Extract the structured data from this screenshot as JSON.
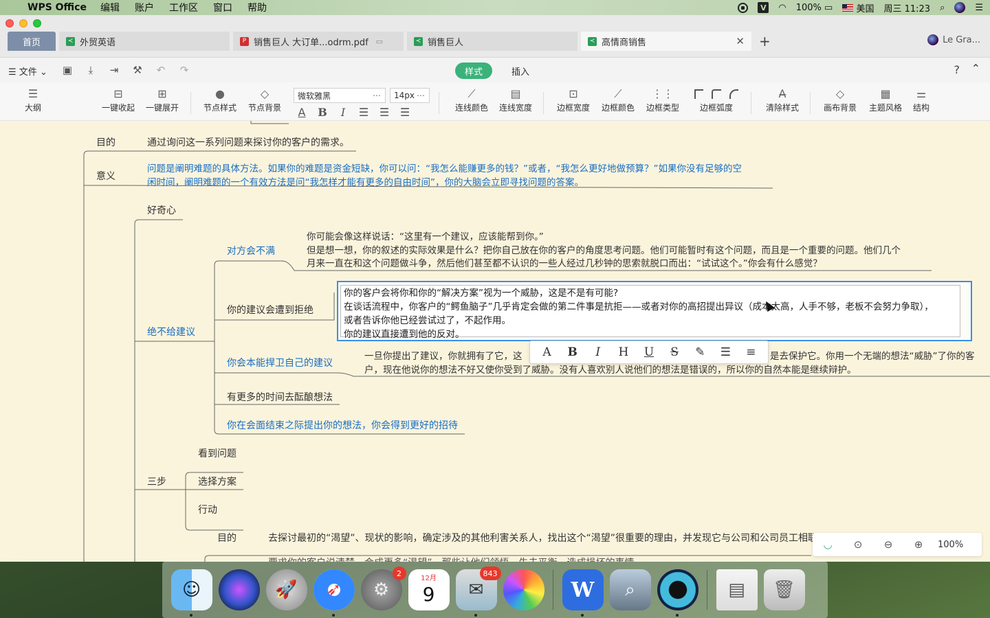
{
  "menubar": {
    "app": "WPS Office",
    "items": [
      "编辑",
      "账户",
      "工作区",
      "窗口",
      "帮助"
    ],
    "battery": "100%",
    "input_source": "美国",
    "clock": "周三 11:23"
  },
  "tabs": {
    "home": "首页",
    "items": [
      "外贸英语",
      "销售巨人 大订单...odrm.pdf",
      "销售巨人",
      "高情商销售"
    ],
    "user": "Le Gra..."
  },
  "toolbar1": {
    "file": "文件",
    "mode_tabs": [
      "样式",
      "插入"
    ],
    "help": "?"
  },
  "toolbar2": {
    "outline": "大纲",
    "collapse_all": "一键收起",
    "expand_all": "一键展开",
    "node_style": "节点样式",
    "node_bg": "节点背景",
    "font_family": "微软雅黑",
    "font_size": "14px",
    "line_color": "连线颜色",
    "line_width": "连线宽度",
    "border_width": "边框宽度",
    "border_color": "边框颜色",
    "border_type": "边框类型",
    "border_radius": "边框弧度",
    "clear_style": "清除样式",
    "canvas_bg": "画布背景",
    "theme": "主题风格",
    "structure": "结构"
  },
  "mindmap": {
    "purpose_label": "目的",
    "purpose_text": "通过询问这一系列问题来探讨你的客户的需求。",
    "meaning_label": "意义",
    "meaning_line1": "问题是阐明难题的具体方法。如果你的难题是资金短缺，你可以问：“我怎么能赚更多的钱？”或者，“我怎么更好地做预算？”如果你没有足够的空",
    "meaning_line2": "闲时间，阐明难题的一个有效方法是问“我怎样才能有更多的自由时间”，你的大脑会立即寻找问题的答案。",
    "curiosity": "好奇心",
    "never_advise": "绝不给建议",
    "dissatisfied": "对方会不满",
    "dissatisfied_line1": "你可能会像这样说话：“这里有一个建议，应该能帮到你。”",
    "dissatisfied_line2": "但是想一想，你的叙述的实际效果是什么？把你自己放在你的客户的角度思考问题。他们可能暂时有这个问题，而且是一个重要的问题。他们几个",
    "dissatisfied_line3": "月来一直在和这个问题做斗争，然后他们甚至都不认识的一些人经过几秒钟的思索就脱口而出：“试试这个。”你会有什么感觉？",
    "rejected": "你的建议会遭到拒绝",
    "edit_line1": "你的客户会将你和你的“解决方案”视为一个威胁，这是不是有可能?",
    "edit_line2": "在谈话流程中，你客户的“鳄鱼脑子”几乎肯定会做的第二件事是抗拒——或者对你的高招提出异议（成本太高，人手不够，老板不会努力争取），",
    "edit_line3": "或者告诉你他已经尝试过了，不起作用。",
    "edit_line4": "你的建议直接遭到他的反对。",
    "defend": "你会本能捍卫自己的建议",
    "defend_line1_a": "一旦你提出了建议，你就拥有了它，这",
    "defend_line1_b": "是去保护它。你用一个无端的想法“威胁”了你的客",
    "defend_line2": "户，现在他说你的想法不好又使你受到了威胁。没有人喜欢别人说他们的想法是错误的，所以你的自然本能是继续辩护。",
    "more_time": "有更多的时间去酝酿想法",
    "end_meeting": "你在会面结束之际提出你的想法，你会得到更好的招待",
    "three_steps": "三步",
    "see_problem": "看到问题",
    "choose_plan": "选择方案",
    "action": "行动",
    "purpose2_label": "目的",
    "purpose2_text": "去探讨最初的“渴望”、现状的影响，确定涉及的其他利害关系人，找出这个“渴望”很重要的理由，并发现它与公司和公司员工相联系",
    "cut_line": "要求你的客户说清楚，会成更多“渴望”。那些让他们领悟、失去平衡，造成损坏的事情"
  },
  "float_toolbar": [
    "A",
    "B",
    "I",
    "H",
    "U",
    "S",
    "✎",
    "☰",
    "≡"
  ],
  "zoom": {
    "level": "100%"
  },
  "dock": {
    "settings_badge": "2",
    "calendar_month": "12月",
    "calendar_day": "9",
    "mail_badge": "843"
  }
}
